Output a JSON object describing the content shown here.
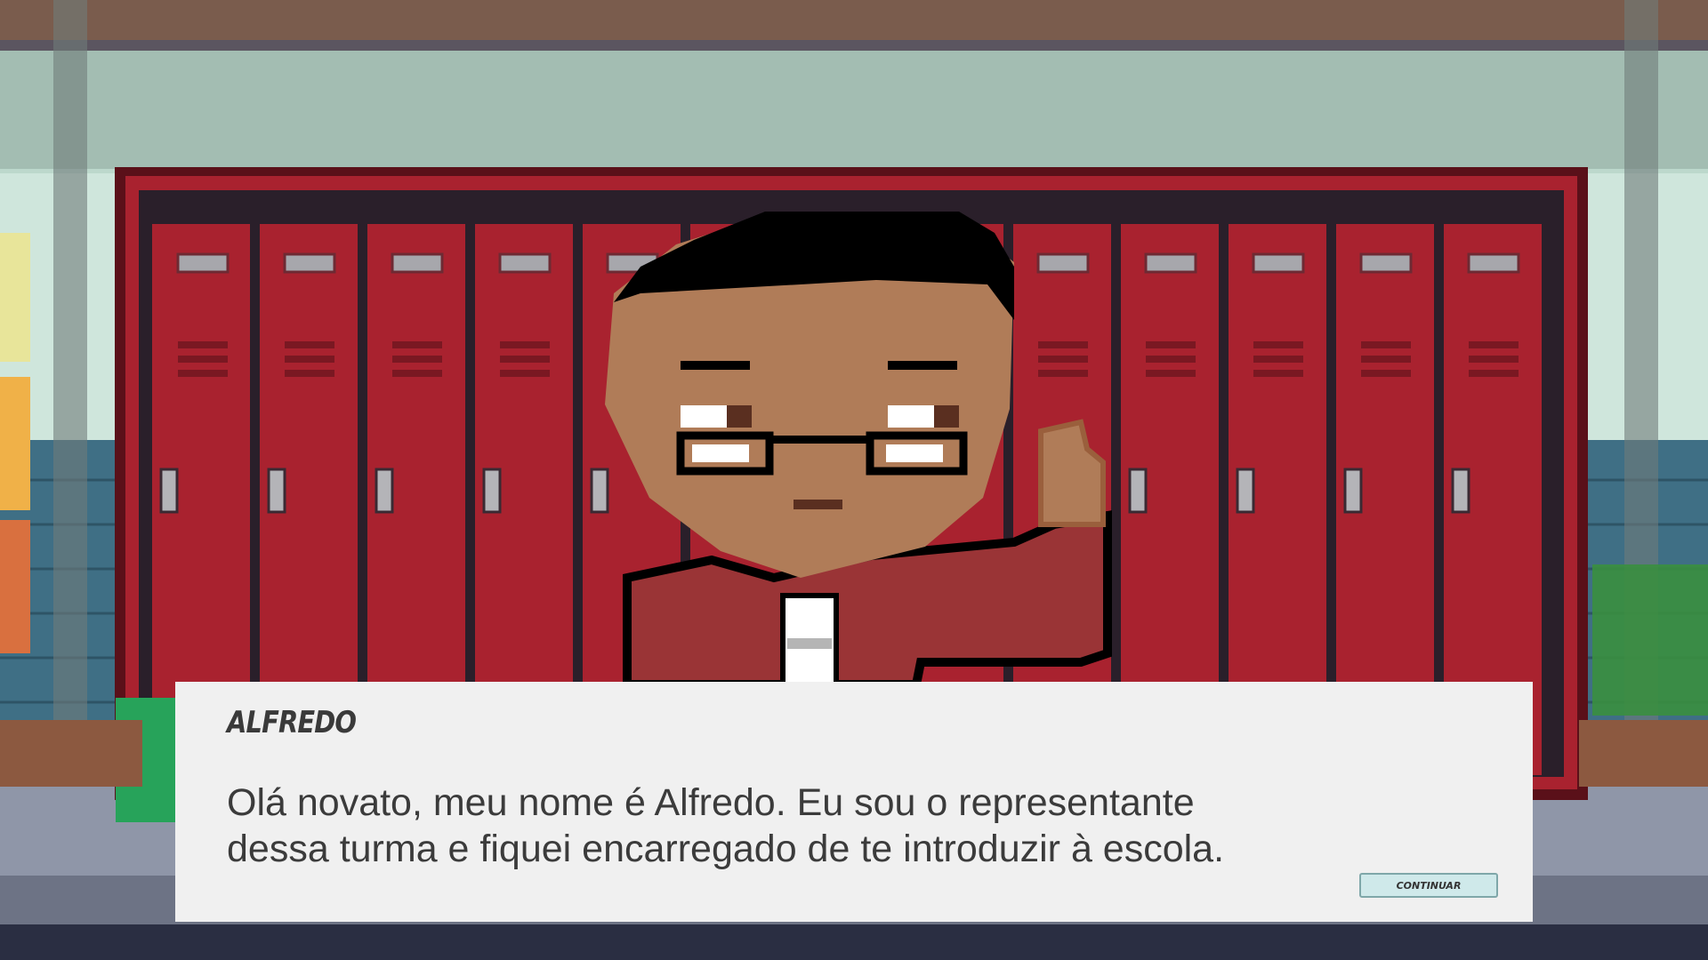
{
  "dialog": {
    "speaker": "ALFREDO",
    "line1": "Olá novato, meu nome é Alfredo. Eu sou o representante",
    "line2": "dessa turma e fiquei encarregado de te introduzir à escola.",
    "continue_label": "CONTINUAR"
  },
  "colors": {
    "locker": "#a9222f",
    "wall": "#a3bdb2",
    "skin": "#b07c58",
    "jacket": "#9a3436",
    "dialog_bg": "#f0f0f0",
    "button_bg": "#cfe9ea"
  }
}
